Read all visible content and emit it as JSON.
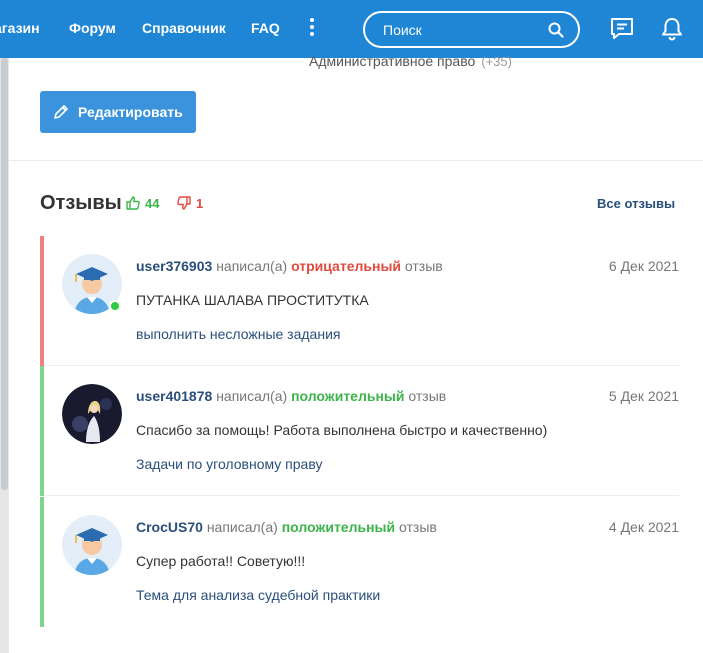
{
  "nav": {
    "items": [
      "агазин",
      "Форум",
      "Справочник",
      "FAQ"
    ],
    "search_placeholder": "Поиск"
  },
  "previous": {
    "category": "Административное право",
    "count": "(+35)"
  },
  "edit_button": "Редактировать",
  "reviews": {
    "title": "Отзывы",
    "likes": "44",
    "dislikes": "1",
    "all_link": "Все отзывы",
    "items": [
      {
        "user": "user376903",
        "wrote": "написал(а)",
        "type": "отрицательный",
        "word": "отзыв",
        "date": "6 Дек 2021",
        "text": "ПУТАНКА ШАЛАВА ПРОСТИТУТКА",
        "link": "выполнить несложные задания"
      },
      {
        "user": "user401878",
        "wrote": "написал(а)",
        "type": "положительный",
        "word": "отзыв",
        "date": "5 Дек 2021",
        "text": "Спасибо за помощь! Работа выполнена быстро и качественно)",
        "link": "Задачи по уголовному праву"
      },
      {
        "user": "CrocUS70",
        "wrote": "написал(а)",
        "type": "положительный",
        "word": "отзыв",
        "date": "4 Дек 2021",
        "text": "Супер работа!! Советую!!!",
        "link": "Тема для анализа судебной практики"
      }
    ]
  },
  "colors": {
    "nav_bg": "#1f86d6",
    "negative": "#e04a3f",
    "positive": "#3cb44b",
    "link": "#2a4f7a"
  }
}
